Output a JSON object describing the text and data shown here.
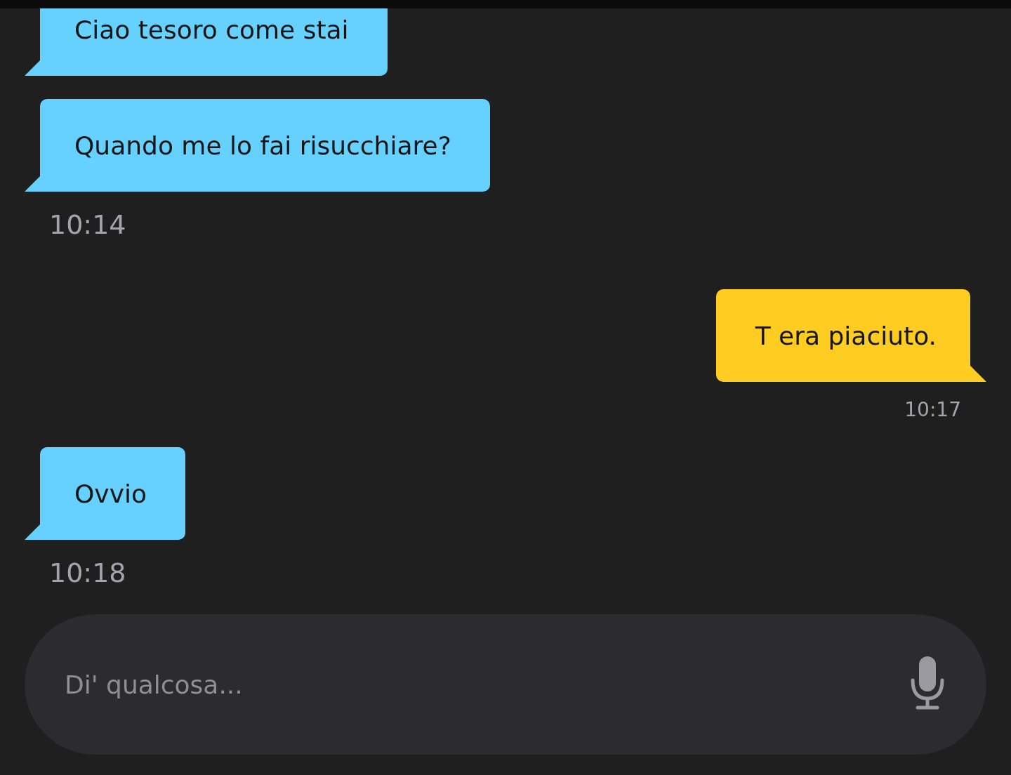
{
  "messages": [
    {
      "kind": "incoming",
      "text": "Ciao tesoro come stai"
    },
    {
      "kind": "incoming",
      "text": "Quando me lo fai risucchiare?",
      "time": "10:14"
    },
    {
      "kind": "outgoing",
      "text": "T era piaciuto.",
      "time": "10:17"
    },
    {
      "kind": "incoming",
      "text": "Ovvio",
      "time": "10:18"
    }
  ],
  "composer": {
    "placeholder": "Di' qualcosa..."
  }
}
